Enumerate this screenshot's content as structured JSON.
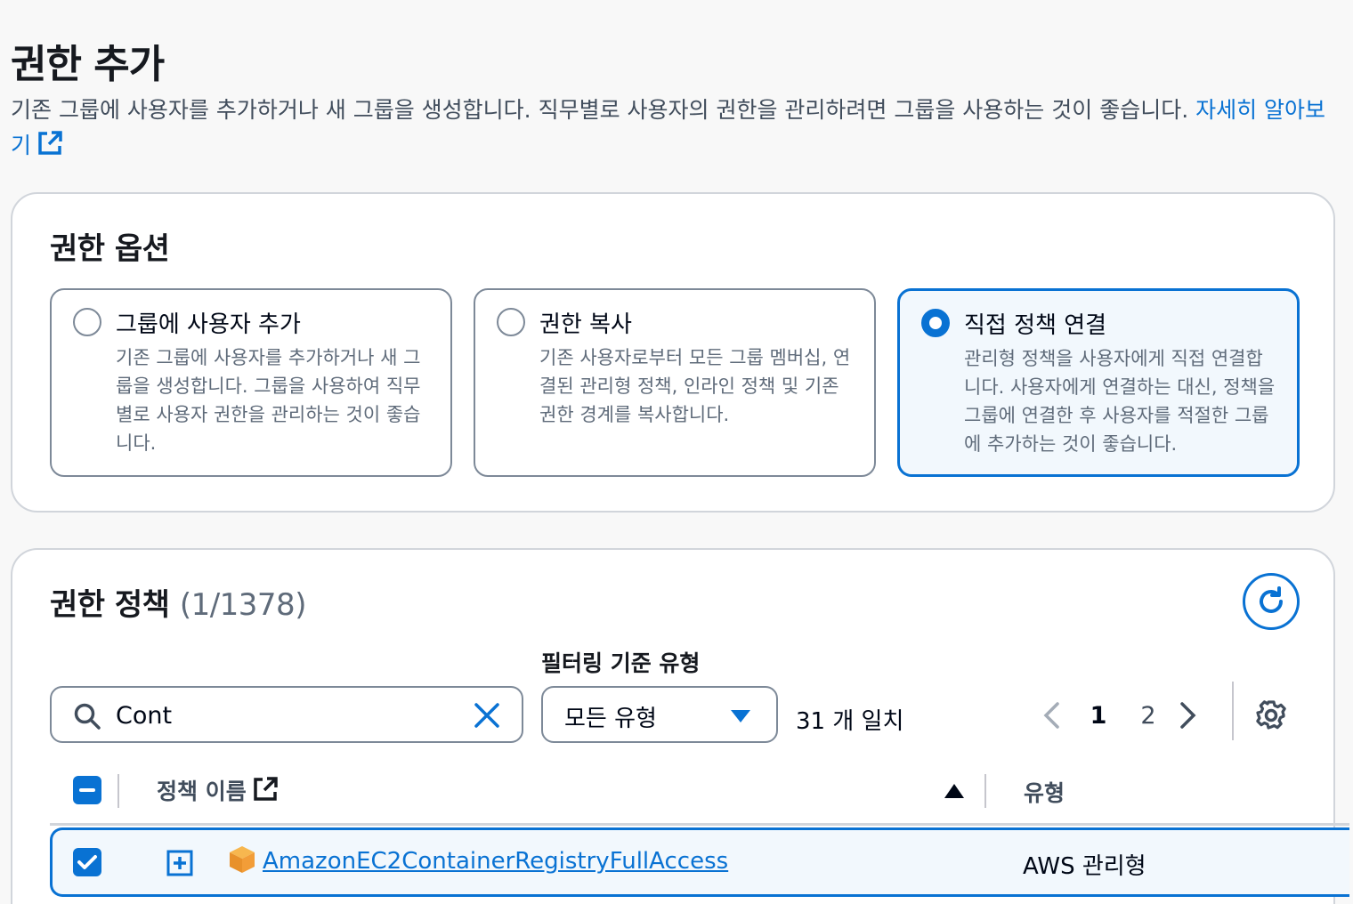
{
  "header": {
    "title": "권한 추가",
    "description": "기존 그룹에 사용자를 추가하거나 새 그룹을 생성합니다. 직무별로 사용자의 권한을 관리하려면 그룹을 사용하는 것이 좋습니다. ",
    "learn_more": "자세히 알아보기"
  },
  "options": {
    "title": "권한 옵션",
    "tiles": [
      {
        "title": "그룹에 사용자 추가",
        "desc": "기존 그룹에 사용자를 추가하거나 새 그룹을 생성합니다. 그룹을 사용하여 직무별로 사용자 권한을 관리하는 것이 좋습니다."
      },
      {
        "title": "권한 복사",
        "desc": "기존 사용자로부터 모든 그룹 멤버십, 연결된 관리형 정책, 인라인 정책 및 기존 권한 경계를 복사합니다."
      },
      {
        "title": "직접 정책 연결",
        "desc": "관리형 정책을 사용자에게 직접 연결합니다. 사용자에게 연결하는 대신, 정책을 그룹에 연결한 후 사용자를 적절한 그룹에 추가하는 것이 좋습니다."
      }
    ],
    "selected_index": 2
  },
  "policies": {
    "title": "권한 정책",
    "count": "(1/1378)",
    "filter_label": "필터링 기준 유형",
    "search_value": "Cont",
    "type_filter": "모든 유형",
    "match_count": "31 개 일치",
    "pages": [
      "1",
      "2"
    ],
    "current_page": "1",
    "columns": {
      "name": "정책 이름",
      "type": "유형"
    },
    "rows": [
      {
        "name": "AmazonEC2ContainerRegistryFullAccess",
        "type": "AWS 관리형",
        "checked": true
      }
    ]
  },
  "colors": {
    "accent": "#0972d3",
    "border": "#7d8998",
    "text": "#16191f",
    "muted": "#5f6b7a"
  }
}
